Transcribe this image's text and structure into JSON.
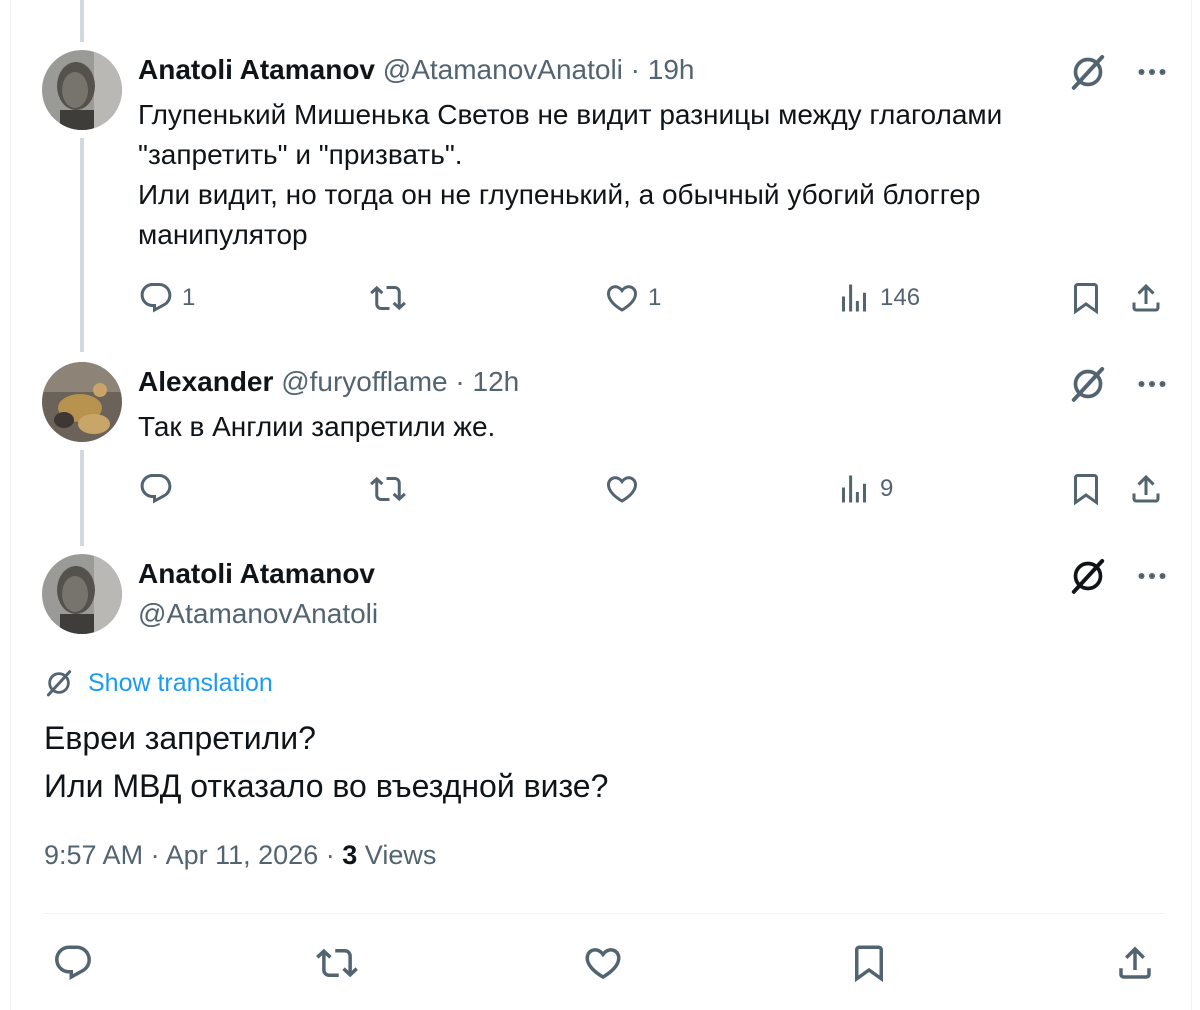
{
  "replies": [
    {
      "name": "Anatoli Atamanov",
      "handle": "@AtamanovAnatoli",
      "separator": "·",
      "time": "19h",
      "lines": [
        "Глупенький Мишенька Светов не видит разницы между глаголами",
        "\"запретить\" и \"призвать\".",
        "Или видит, но тогда он не глупенький, а обычный убогий блоггер",
        "манипулятор"
      ],
      "reply_count": "1",
      "like_count": "1",
      "view_count": "146"
    },
    {
      "name": "Alexander",
      "handle": "@furyofflame",
      "separator": "·",
      "time": "12h",
      "lines": [
        "Так в Англии запретили же."
      ],
      "reply_count": "",
      "like_count": "",
      "view_count": "9"
    }
  ],
  "main_tweet": {
    "name": "Anatoli Atamanov",
    "handle": "@AtamanovAnatoli",
    "show_translation": "Show translation",
    "lines": [
      "Евреи запретили?",
      "Или МВД отказало во въездной визе?"
    ],
    "time": "9:57 AM",
    "separator": "·",
    "date": "Apr 11, 2026",
    "views_count": "3",
    "views_label": "Views"
  },
  "icons": {
    "reply": "reply-icon",
    "retweet": "retweet-icon",
    "like": "heart-icon",
    "views": "views-icon",
    "bookmark": "bookmark-icon",
    "share": "share-icon",
    "grok": "grok-icon",
    "more": "more-icon"
  },
  "colors": {
    "link": "#1d9bf0",
    "secondary_text": "#536471",
    "thread_line": "#cfd9de"
  }
}
